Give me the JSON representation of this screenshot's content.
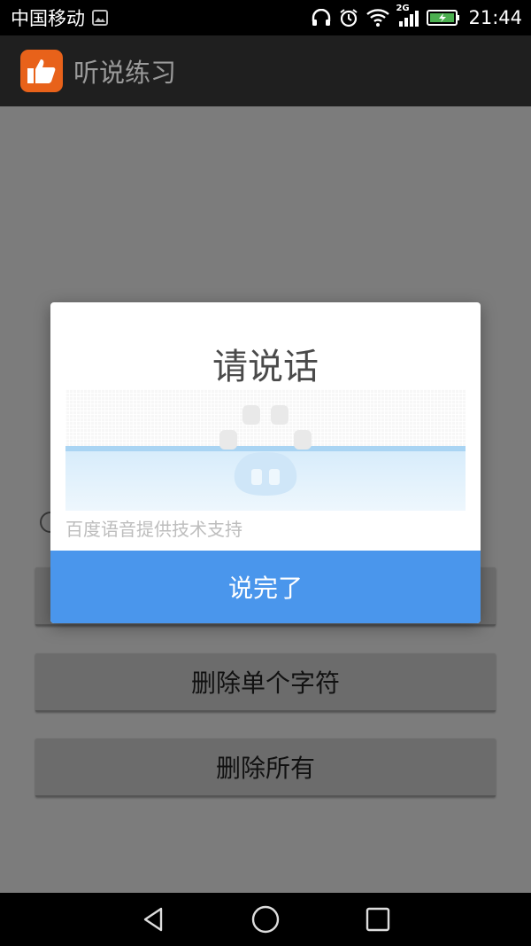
{
  "status_bar": {
    "carrier": "中国移动",
    "network": "2G",
    "time": "21:44"
  },
  "app_bar": {
    "title": "听说练习",
    "logo_icon": "thumbs-up-icon"
  },
  "main": {
    "hidden_button_label": "",
    "delete_char_label": "删除单个字符",
    "delete_all_label": "删除所有"
  },
  "dialog": {
    "title": "请说话",
    "support_text": "百度语音提供技术支持",
    "done_label": "说完了",
    "logo_icon": "baidu-paw-icon"
  },
  "nav": {
    "back_icon": "back-triangle-icon",
    "home_icon": "home-circle-icon",
    "recents_icon": "recents-square-icon"
  },
  "colors": {
    "accent": "#4a96ec",
    "app_logo": "#e8621a"
  }
}
